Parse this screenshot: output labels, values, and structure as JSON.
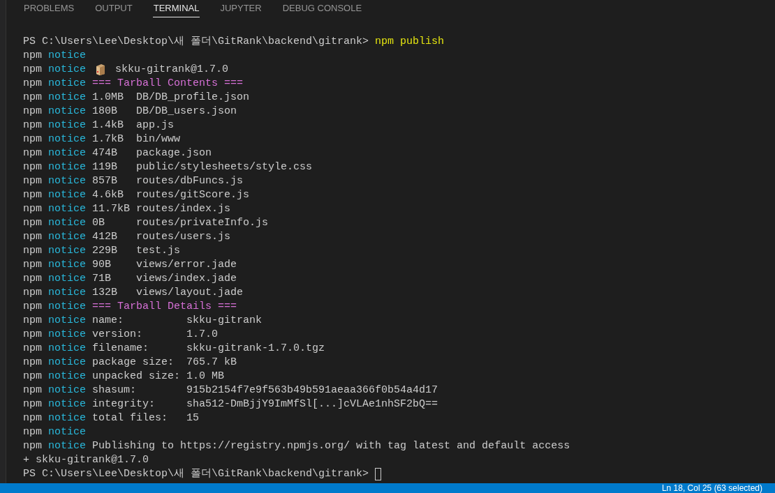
{
  "tabs": [
    {
      "label": "PROBLEMS",
      "selected": false
    },
    {
      "label": "OUTPUT",
      "selected": false
    },
    {
      "label": "TERMINAL",
      "selected": true
    },
    {
      "label": "JUPYTER",
      "selected": false
    },
    {
      "label": "DEBUG CONSOLE",
      "selected": false
    }
  ],
  "terminal": {
    "lines": [
      {
        "kind": "prompt",
        "path": "PS C:\\Users\\Lee\\Desktop\\새 폴더\\GitRank\\backend\\gitrank>",
        "command": "npm publish"
      },
      {
        "kind": "notice",
        "npm": "npm",
        "tag": "notice"
      },
      {
        "kind": "package",
        "npm": "npm",
        "tag": "notice",
        "text": "skku-gitrank@1.7.0"
      },
      {
        "kind": "section",
        "npm": "npm",
        "tag": "notice",
        "text": "=== Tarball Contents ==="
      },
      {
        "kind": "file",
        "npm": "npm",
        "tag": "notice",
        "size": "1.0MB",
        "path": "DB/DB_profile.json"
      },
      {
        "kind": "file",
        "npm": "npm",
        "tag": "notice",
        "size": "180B",
        "path": "DB/DB_users.json"
      },
      {
        "kind": "file",
        "npm": "npm",
        "tag": "notice",
        "size": "1.4kB",
        "path": "app.js"
      },
      {
        "kind": "file",
        "npm": "npm",
        "tag": "notice",
        "size": "1.7kB",
        "path": "bin/www"
      },
      {
        "kind": "file",
        "npm": "npm",
        "tag": "notice",
        "size": "474B",
        "path": "package.json"
      },
      {
        "kind": "file",
        "npm": "npm",
        "tag": "notice",
        "size": "119B",
        "path": "public/stylesheets/style.css"
      },
      {
        "kind": "file",
        "npm": "npm",
        "tag": "notice",
        "size": "857B",
        "path": "routes/dbFuncs.js"
      },
      {
        "kind": "file",
        "npm": "npm",
        "tag": "notice",
        "size": "4.6kB",
        "path": "routes/gitScore.js"
      },
      {
        "kind": "file",
        "npm": "npm",
        "tag": "notice",
        "size": "11.7kB",
        "path": "routes/index.js"
      },
      {
        "kind": "file",
        "npm": "npm",
        "tag": "notice",
        "size": "0B",
        "path": "routes/privateInfo.js"
      },
      {
        "kind": "file",
        "npm": "npm",
        "tag": "notice",
        "size": "412B",
        "path": "routes/users.js"
      },
      {
        "kind": "file",
        "npm": "npm",
        "tag": "notice",
        "size": "229B",
        "path": "test.js"
      },
      {
        "kind": "file",
        "npm": "npm",
        "tag": "notice",
        "size": "90B",
        "path": "views/error.jade"
      },
      {
        "kind": "file",
        "npm": "npm",
        "tag": "notice",
        "size": "71B",
        "path": "views/index.jade"
      },
      {
        "kind": "file",
        "npm": "npm",
        "tag": "notice",
        "size": "132B",
        "path": "views/layout.jade"
      },
      {
        "kind": "section",
        "npm": "npm",
        "tag": "notice",
        "text": "=== Tarball Details ==="
      },
      {
        "kind": "detail",
        "npm": "npm",
        "tag": "notice",
        "key": "name:",
        "value": "skku-gitrank"
      },
      {
        "kind": "detail",
        "npm": "npm",
        "tag": "notice",
        "key": "version:",
        "value": "1.7.0"
      },
      {
        "kind": "detail",
        "npm": "npm",
        "tag": "notice",
        "key": "filename:",
        "value": "skku-gitrank-1.7.0.tgz"
      },
      {
        "kind": "detail",
        "npm": "npm",
        "tag": "notice",
        "key": "package size:",
        "value": "765.7 kB"
      },
      {
        "kind": "detail",
        "npm": "npm",
        "tag": "notice",
        "key": "unpacked size:",
        "value": "1.0 MB"
      },
      {
        "kind": "detail",
        "npm": "npm",
        "tag": "notice",
        "key": "shasum:",
        "value": "915b2154f7e9f563b49b591aeaa366f0b54a4d17"
      },
      {
        "kind": "detail",
        "npm": "npm",
        "tag": "notice",
        "key": "integrity:",
        "value": "sha512-DmBjjY9ImMfSl[...]cVLAe1nhSF2bQ=="
      },
      {
        "kind": "detail",
        "npm": "npm",
        "tag": "notice",
        "key": "total files:",
        "value": "15"
      },
      {
        "kind": "notice",
        "npm": "npm",
        "tag": "notice"
      },
      {
        "kind": "text",
        "npm": "npm",
        "tag": "notice",
        "text": "Publishing to https://registry.npmjs.org/ with tag latest and default access"
      },
      {
        "kind": "output",
        "text": "+ skku-gitrank@1.7.0"
      },
      {
        "kind": "prompt",
        "path": "PS C:\\Users\\Lee\\Desktop\\새 폴더\\GitRank\\backend\\gitrank>",
        "cursor": true
      }
    ]
  },
  "status_bar": {
    "text": "Ln 18, Col 25 (63 selected)"
  }
}
